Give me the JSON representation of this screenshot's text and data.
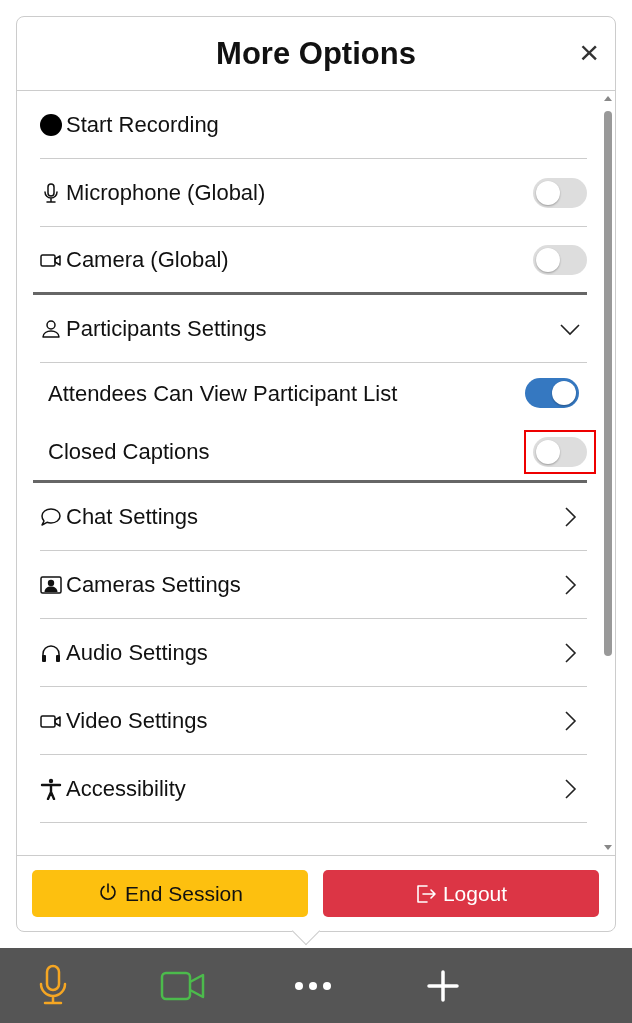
{
  "dialog": {
    "title": "More Options",
    "close": "×"
  },
  "items": [
    {
      "kind": "action",
      "label": "Start Recording"
    },
    {
      "kind": "toggle",
      "label": "Microphone (Global)",
      "on": false,
      "highlighted": false
    },
    {
      "kind": "toggle",
      "label": "Camera (Global)",
      "on": false,
      "highlighted": false
    },
    {
      "kind": "section",
      "label": "Participants Settings",
      "expanded": true
    },
    {
      "kind": "subtoggle",
      "label": "Attendees Can View Participant List",
      "on": true,
      "highlighted": false
    },
    {
      "kind": "subtoggle",
      "label": "Closed Captions",
      "on": false,
      "highlighted": true
    },
    {
      "kind": "nav",
      "label": "Chat Settings"
    },
    {
      "kind": "nav",
      "label": "Cameras Settings"
    },
    {
      "kind": "nav",
      "label": "Audio Settings"
    },
    {
      "kind": "nav",
      "label": "Video Settings"
    },
    {
      "kind": "nav",
      "label": "Accessibility"
    }
  ],
  "footer_buttons": [
    {
      "kind": "end",
      "label": "End Session"
    },
    {
      "kind": "logout",
      "label": "Logout"
    }
  ],
  "toolbar": [
    {
      "kind": "mic",
      "color": "#f5a623"
    },
    {
      "kind": "video",
      "color": "#4cbb4c"
    },
    {
      "kind": "more"
    },
    {
      "kind": "add"
    }
  ]
}
